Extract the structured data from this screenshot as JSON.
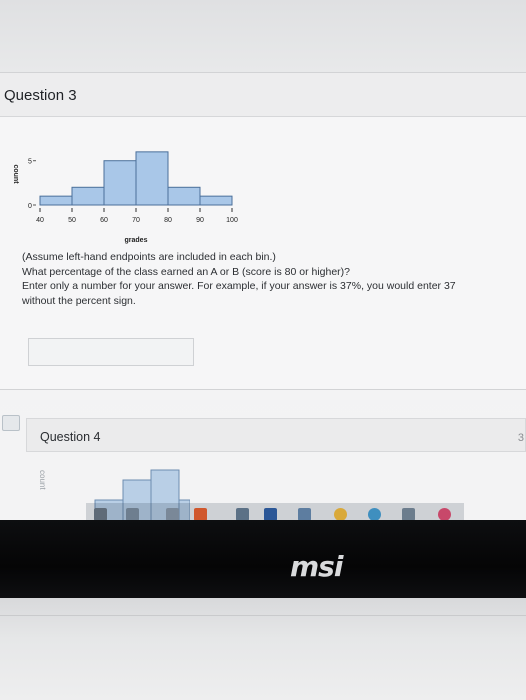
{
  "question3": {
    "title": "Question 3",
    "lines": [
      "(Assume left-hand endpoints are included in each bin.)",
      "What percentage of the class earned an A or B (score is 80 or higher)?",
      "Enter only a number for your answer. For example, if your answer is 37%, you would enter 37",
      "without the percent sign."
    ],
    "answer_value": ""
  },
  "question4": {
    "title": "Question 4",
    "side_number": "3"
  },
  "chart_data": {
    "type": "bar",
    "xlabel": "grades",
    "ylabel": "count",
    "x_ticks": [
      "40",
      "50",
      "60",
      "70",
      "80",
      "90",
      "100"
    ],
    "y_ticks": [
      "0",
      "5"
    ],
    "bins": [
      [
        40,
        50
      ],
      [
        50,
        60
      ],
      [
        60,
        70
      ],
      [
        70,
        80
      ],
      [
        80,
        90
      ],
      [
        90,
        100
      ]
    ],
    "values": [
      1,
      2,
      5,
      6,
      2,
      1
    ],
    "ylim": [
      0,
      7
    ],
    "bar_color": "#a9c7e8",
    "bar_edge_color": "#4a6f9a"
  },
  "laptop": {
    "brand": "msi"
  },
  "taskbar": {
    "icons": [
      "calculator-icon",
      "photos-icon",
      "camera-icon",
      "office-icon",
      "file-icon",
      "word-icon",
      "mail-icon",
      "chrome-icon",
      "store-icon",
      "app-icon",
      "media-icon"
    ]
  }
}
